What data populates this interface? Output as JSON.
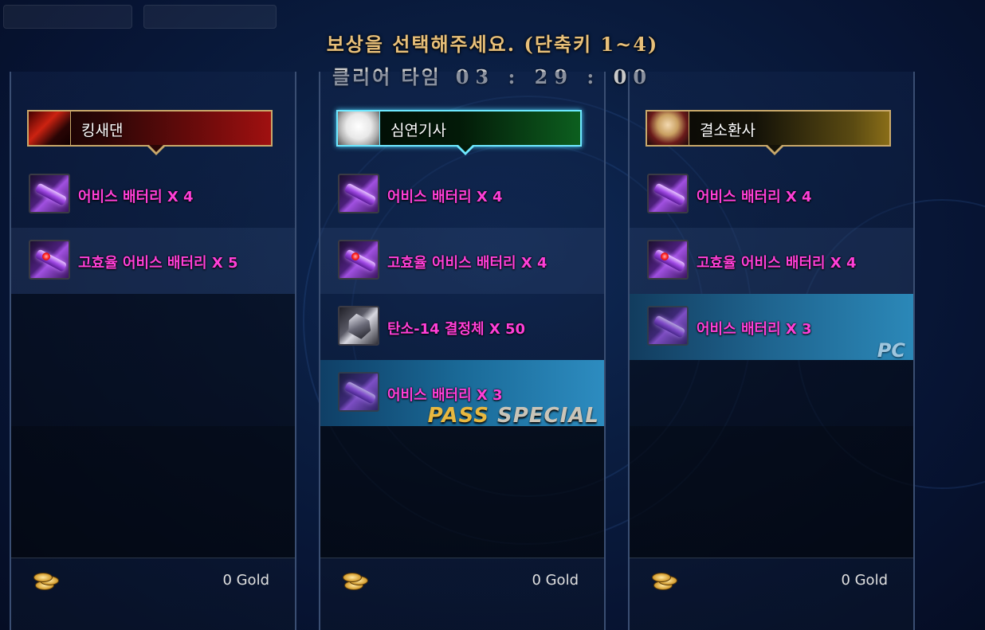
{
  "header": {
    "title": "보상을 선택해주세요. (단축키 1~4)",
    "clear_label": "클리어 타임",
    "clear_time": "03 : 29 : 00"
  },
  "columns": [
    {
      "name": "킹새댄",
      "theme": "red",
      "rewards": [
        {
          "label": "어비스 배터리 X 4",
          "icon": "abyss-battery-icon"
        },
        {
          "label": "고효율 어비스 배터리 X 5",
          "icon": "high-efficiency-abyss-battery-icon"
        }
      ],
      "gold": "0 Gold"
    },
    {
      "name": "심연기사",
      "theme": "green",
      "selected": true,
      "rewards": [
        {
          "label": "어비스 배터리 X 4",
          "icon": "abyss-battery-icon"
        },
        {
          "label": "고효율 어비스 배터리 X 4",
          "icon": "high-efficiency-abyss-battery-icon"
        },
        {
          "label": "탄소-14 결정체 X 50",
          "icon": "carbon-crystal-icon"
        },
        {
          "label": "어비스 배터리 X 3",
          "icon": "abyss-battery-icon",
          "badge_a": "PASS",
          "badge_b": "SPECIAL"
        }
      ],
      "gold": "0 Gold"
    },
    {
      "name": "결소환사",
      "theme": "gold",
      "rewards": [
        {
          "label": "어비스 배터리 X 4",
          "icon": "abyss-battery-icon"
        },
        {
          "label": "고효율 어비스 배터리 X 4",
          "icon": "high-efficiency-abyss-battery-icon"
        },
        {
          "label": "어비스 배터리 X 3",
          "icon": "abyss-battery-icon",
          "badge": "PC"
        }
      ],
      "gold": "0 Gold"
    }
  ],
  "colors": {
    "reward_text": "#ff3fd8",
    "title": "#e8c07a",
    "pass": "#e8b840"
  }
}
